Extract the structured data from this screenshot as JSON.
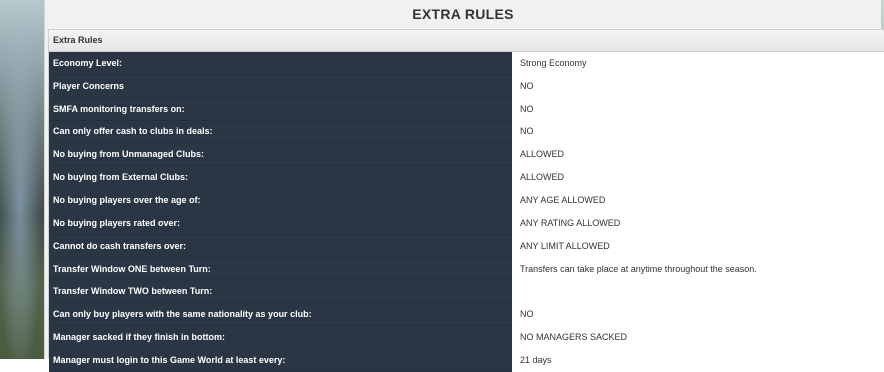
{
  "page_title": "EXTRA RULES",
  "section_title": "Extra Rules",
  "rules": [
    {
      "label": "Economy Level:",
      "value": "Strong Economy"
    },
    {
      "label": "Player Concerns",
      "value": "NO"
    },
    {
      "label": "SMFA monitoring transfers on:",
      "value": "NO"
    },
    {
      "label": "Can only offer cash to clubs in deals:",
      "value": "NO"
    },
    {
      "label": "No buying from Unmanaged Clubs:",
      "value": "ALLOWED"
    },
    {
      "label": "No buying from External Clubs:",
      "value": "ALLOWED"
    },
    {
      "label": "No buying players over the age of:",
      "value": "ANY AGE ALLOWED"
    },
    {
      "label": "No buying players rated over:",
      "value": "ANY RATING ALLOWED"
    },
    {
      "label": "Cannot do cash transfers over:",
      "value": "ANY LIMIT ALLOWED"
    },
    {
      "label": "Transfer Window ONE between Turn:",
      "value": "Transfers can take place at anytime throughout the season."
    },
    {
      "label": "Transfer Window TWO between Turn:",
      "value": ""
    },
    {
      "label": "Can only buy players with the same nationality as your club:",
      "value": "NO"
    },
    {
      "label": "Manager sacked if they finish in bottom:",
      "value": "NO MANAGERS SACKED"
    },
    {
      "label": "Manager must login to this Game World at least every:",
      "value": "21 days"
    }
  ]
}
